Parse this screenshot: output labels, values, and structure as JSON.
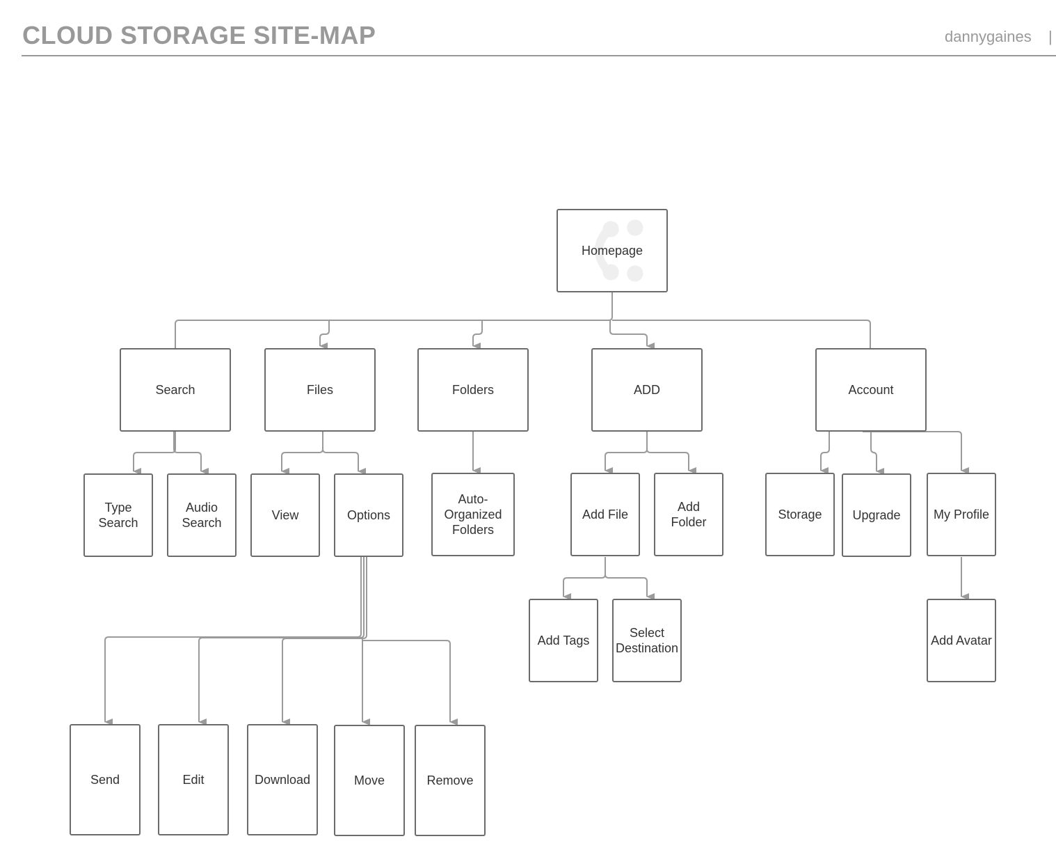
{
  "header": {
    "title": "CLOUD STORAGE SITE-MAP",
    "author": "dannygaines",
    "separator": "|"
  },
  "nodes": {
    "homepage": "Homepage",
    "search": "Search",
    "files": "Files",
    "folders": "Folders",
    "add": "ADD",
    "account": "Account",
    "type_search": "Type\nSearch",
    "audio_search": "Audio\nSearch",
    "view": "View",
    "options": "Options",
    "auto_folders": "Auto-\nOrganized\nFolders",
    "add_file": "Add File",
    "add_folder": "Add Folder",
    "storage": "Storage",
    "upgrade": "Upgrade",
    "my_profile": "My Profile",
    "add_tags": "Add Tags",
    "select_destination": "Select\nDestination",
    "add_avatar": "Add Avatar",
    "send": "Send",
    "edit": "Edit",
    "download": "Download",
    "move": "Move",
    "remove": "Remove"
  },
  "edges": [
    [
      "homepage",
      "search"
    ],
    [
      "homepage",
      "files"
    ],
    [
      "homepage",
      "folders"
    ],
    [
      "homepage",
      "add"
    ],
    [
      "homepage",
      "account"
    ],
    [
      "search",
      "type_search"
    ],
    [
      "search",
      "audio_search"
    ],
    [
      "files",
      "view"
    ],
    [
      "files",
      "options"
    ],
    [
      "folders",
      "auto_folders"
    ],
    [
      "add",
      "add_file"
    ],
    [
      "add",
      "add_folder"
    ],
    [
      "account",
      "storage"
    ],
    [
      "account",
      "upgrade"
    ],
    [
      "account",
      "my_profile"
    ],
    [
      "add_file",
      "add_tags"
    ],
    [
      "add_file",
      "select_destination"
    ],
    [
      "my_profile",
      "add_avatar"
    ],
    [
      "options",
      "send"
    ],
    [
      "options",
      "edit"
    ],
    [
      "options",
      "download"
    ],
    [
      "options",
      "move"
    ],
    [
      "options",
      "remove"
    ]
  ],
  "colors": {
    "connector": "#9a9a9a",
    "node_border": "#6b6b6b",
    "title": "#999999"
  }
}
